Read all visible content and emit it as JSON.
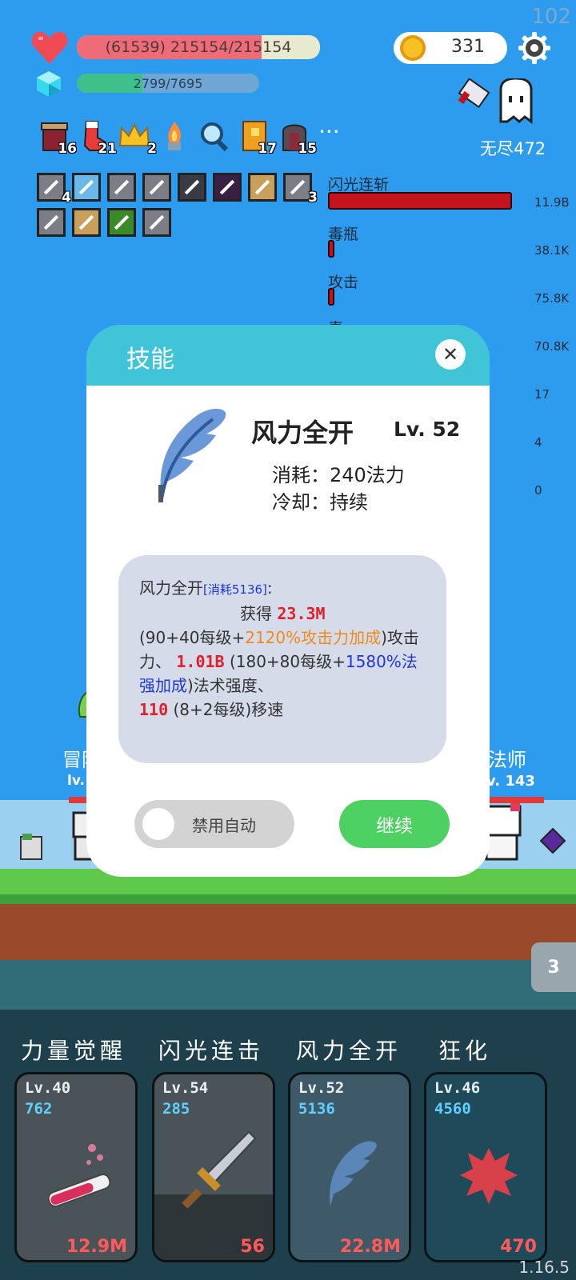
{
  "hud": {
    "fps": "102",
    "hp_text": "(61539) 215154/215154",
    "mp_text": "2799/7695",
    "coins": "331",
    "endless": "无尽472"
  },
  "items": [
    {
      "name": "jar-icon",
      "count": "16"
    },
    {
      "name": "sock-icon",
      "count": "21"
    },
    {
      "name": "crown-icon",
      "count": "2"
    },
    {
      "name": "flame-icon",
      "count": ""
    },
    {
      "name": "magnifier-icon",
      "count": ""
    },
    {
      "name": "book-icon",
      "count": "17"
    },
    {
      "name": "door-icon",
      "count": "15"
    }
  ],
  "more_label": "···",
  "buffs": [
    {
      "count": "4"
    },
    {
      "count": ""
    },
    {
      "count": ""
    },
    {
      "count": ""
    },
    {
      "count": ""
    },
    {
      "count": ""
    },
    {
      "count": ""
    },
    {
      "count": "3"
    },
    {
      "count": ""
    },
    {
      "count": ""
    },
    {
      "count": ""
    },
    {
      "count": ""
    }
  ],
  "damage_stats": [
    {
      "name": "闪光连斩",
      "value": "11.9B",
      "fraction": 1.0
    },
    {
      "name": "毒瓶",
      "value": "38.1K",
      "fraction": 0.01
    },
    {
      "name": "攻击",
      "value": "75.8K",
      "fraction": 0.01
    },
    {
      "name": "毒",
      "value": "70.8K",
      "fraction": 0.01
    },
    {
      "name": "",
      "value": "17",
      "fraction": 0
    },
    {
      "name": "",
      "value": "4",
      "fraction": 0
    },
    {
      "name": "",
      "value": "0",
      "fraction": 0
    }
  ],
  "scene": {
    "left_name": "冒险",
    "left_lv": "lv.",
    "right_name": "魔法师",
    "right_lv": "v. 143"
  },
  "modal": {
    "title": "技能",
    "skill_name": "风力全开",
    "skill_level": "Lv. 52",
    "cost": "消耗：240法力",
    "cooldown": "冷却：持续",
    "desc": {
      "name": "风力全开",
      "cost_tag": "[消耗5136]",
      "colon": ":",
      "gain": "获得",
      "v1": "23.3M",
      "t1": "(90+40每级+",
      "o1": "2120%攻击力加成",
      "t2": ")攻击力、",
      "v2": "1.01B",
      "t3": "(180+80每级+",
      "b1": "1580%法强加成",
      "t4": ")法术强度、",
      "v3": "110",
      "t5": "(8+2每级)移速"
    },
    "toggle_label": "禁用自动",
    "continue_label": "继续"
  },
  "skill_cards": [
    {
      "label": "力量觉醒",
      "lv": "Lv.40",
      "cost": "762",
      "dmg": "12.9M",
      "icon": "potion-icon"
    },
    {
      "label": "闪光连击",
      "lv": "Lv.54",
      "cost": "285",
      "dmg": "56",
      "icon": "sword-icon"
    },
    {
      "label": "风力全开",
      "lv": "Lv.52",
      "cost": "5136",
      "dmg": "22.8M",
      "icon": "feather-icon"
    },
    {
      "label": "狂化",
      "lv": "Lv.46",
      "cost": "4560",
      "dmg": "470",
      "icon": "splat-icon"
    }
  ],
  "side_tab": "3",
  "version": "1.16.5"
}
